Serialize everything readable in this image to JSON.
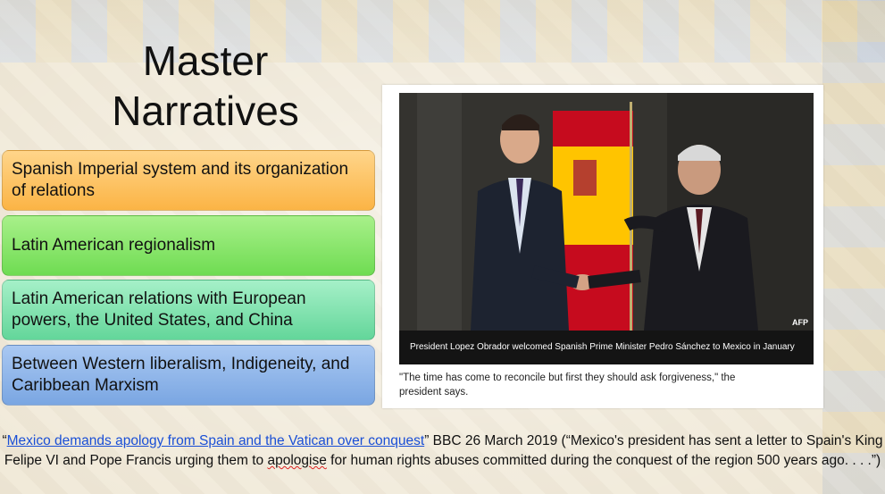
{
  "slide": {
    "title_line1": "Master",
    "title_line2": "Narratives"
  },
  "narratives": [
    {
      "label": "Spanish Imperial system and its organization of relations",
      "color": "#fbb445"
    },
    {
      "label": "Latin American regionalism",
      "color": "#6fdc52"
    },
    {
      "label": "Latin American relations with European powers, the United States, and China",
      "color": "#63d69a"
    },
    {
      "label": "Between Western liberalism, Indigeneity, and Caribbean Marxism",
      "color": "#7aa6e2"
    }
  ],
  "article_card": {
    "photo_credit": "AFP",
    "photo_caption": "President Lopez Obrador welcomed Spanish Prime Minister Pedro Sánchez to Mexico in January",
    "quote_text": "\"The time has come to reconcile but first they should ask forgiveness,\" the president says."
  },
  "citation": {
    "open_quote": "“",
    "link_text": "Mexico demands apology from Spain and the Vatican over conquest",
    "after_link": "” BBC  26 March 2019 (“Mexico's president has sent a letter to Spain's King Felipe VI and Pope Francis urging them to ",
    "misspelled_word": "apologise",
    "tail": " for human rights abuses committed during the conquest of the region 500 years ago. . . .”)"
  }
}
